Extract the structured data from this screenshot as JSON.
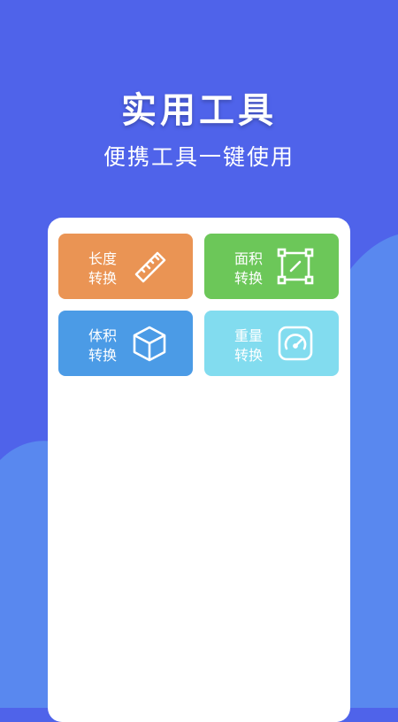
{
  "header": {
    "title": "实用工具",
    "subtitle": "便携工具一键使用"
  },
  "tools": [
    {
      "line1": "长度",
      "line2": "转换",
      "icon": "ruler-icon",
      "color": "#ea9454"
    },
    {
      "line1": "面积",
      "line2": "转换",
      "icon": "area-frame-icon",
      "color": "#6cc759"
    },
    {
      "line1": "体积",
      "line2": "转换",
      "icon": "cube-icon",
      "color": "#4b9be6"
    },
    {
      "line1": "重量",
      "line2": "转换",
      "icon": "scale-gauge-icon",
      "color": "#82dcef"
    }
  ],
  "colors": {
    "background": "#4f63ea",
    "wave": "#5c8ff0",
    "card": "#ffffff"
  }
}
